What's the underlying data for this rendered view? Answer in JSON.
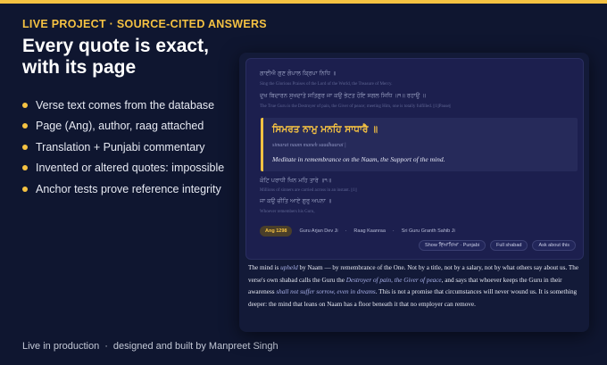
{
  "eyebrow": "LIVE PROJECT · SOURCE-CITED ANSWERS",
  "headline": "Every quote is exact, with its page",
  "bullets": [
    "Verse text comes from the database",
    "Page (Ang), author, raag attached",
    "Translation + Punjabi commentary",
    "Invented or altered quotes: impossible",
    "Anchor tests prove reference integrity"
  ],
  "footer": {
    "left": "Live in production",
    "sep": "·",
    "right": "designed and built by Manpreet Singh"
  },
  "shabad": {
    "lines": [
      {
        "gurmukhi": "ਗਾਈਐ ਗੁਣ ਗੋਪਾਲ ਕ੍ਰਿਪਾ ਨਿਧਿ ॥",
        "translation": "Sing the Glorious Praises of the Lord of the World, the Treasure of Mercy."
      },
      {
        "gurmukhi": "ਦੁਖ ਬਿਦਾਰਨ ਸੁਖਦਾਤੇ ਸਤਿਗੁਰ ਜਾ ਕਉ ਭੇਟਤ ਹੋਇ ਸਗਲ ਸਿਧਿ ॥੧॥ ਰਹਾਉ ॥",
        "translation": "The True Guru is the Destroyer of pain, the Giver of peace; meeting Him, one is totally fulfilled. ||1||Pause||"
      },
      {
        "gurmukhi": "ਕੋਟਿ ਪਰਾਧੀ ਖਿਨ ਮਹਿ ਤਾਰੇ ॥੧॥",
        "translation": "Millions of sinners are carried across in an instant. ||1||"
      },
      {
        "gurmukhi": "ਜਾ ਕਉ ਚੀਤਿ ਆਏ ਗੁਰੁ ਅਪਨਾ ॥",
        "translation": "Whoever remembers his Guru,"
      }
    ],
    "highlight": {
      "gurmukhi": "ਸਿਮਰਤ ਨਾਮੁ ਮਨਹਿ ਸਾਧਾਰੈ ॥",
      "transliteration": "simarat naam maneh saadhaarai |",
      "translation": "Meditate in remembrance on the Naam, the Support of the mind."
    },
    "meta": {
      "ang": "Ang 1298",
      "author": "Guru Arjan Dev Ji",
      "raag": "Raag Kaanraa",
      "source": "Sri Guru Granth Sahib Ji",
      "sep": "·"
    },
    "actions": [
      "Show ਵਿਆਖਿਆ · Punjabi",
      "Full shabad",
      "Ask about this"
    ]
  },
  "commentary": {
    "p1": "The mind is ",
    "e1": "upheld",
    "p2": " by Naam — by remembrance of the One. Not by a title, not by a salary, not by what others say about us. The verse's own shabad calls the Guru the ",
    "e2": "Destroyer of pain, the Giver of peace",
    "p3": ", and says that whoever keeps the Guru in their awareness ",
    "e3": "shall not suffer sorrow, even in dreams",
    "p4": ". This is not a promise that circumstances will never wound us. It is something deeper: the mind that leans on Naam has a floor beneath it that no employer can remove."
  },
  "colors": {
    "accent": "#f5c242",
    "background": "#0f1630",
    "panel": "#1c1f4e"
  }
}
